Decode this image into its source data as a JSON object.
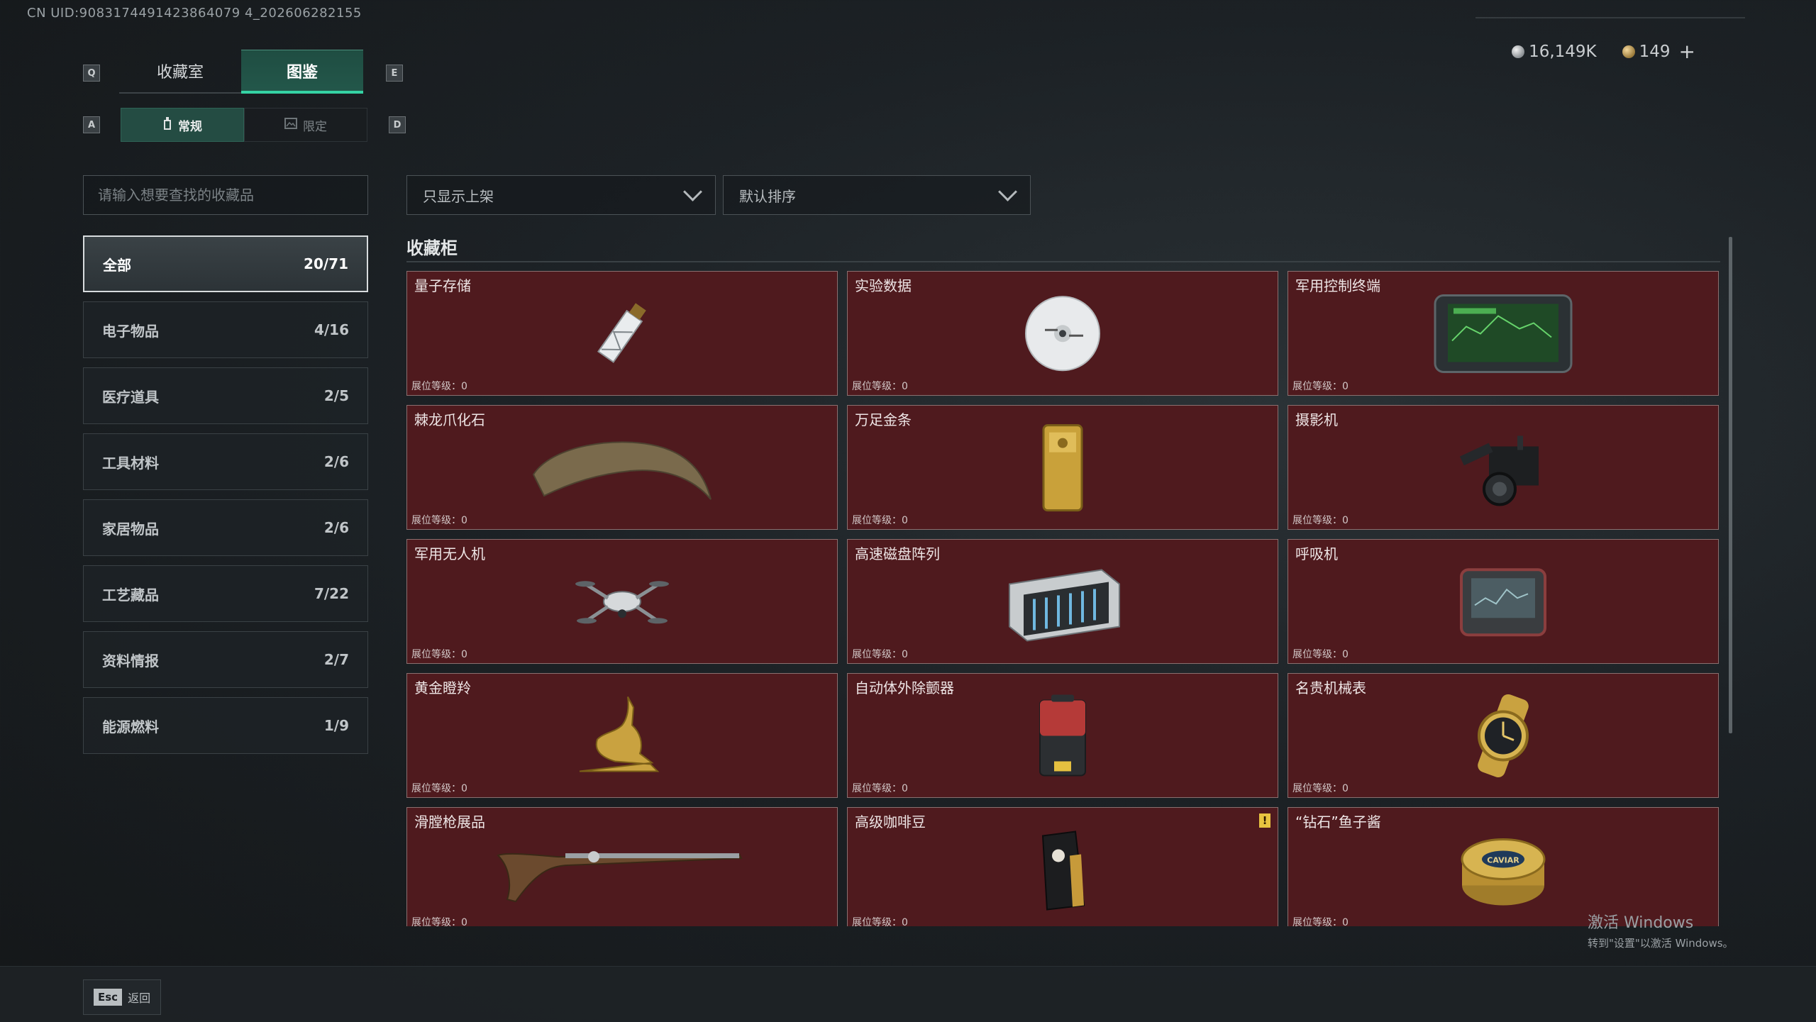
{
  "uid": "CN UID:9083174491423864079 4_202606282155",
  "currency": {
    "silver": "16,149K",
    "gold": "149",
    "plus": "+"
  },
  "keys": {
    "q": "Q",
    "e": "E",
    "a": "A",
    "d": "D"
  },
  "main_tabs": [
    {
      "label": "收藏室"
    },
    {
      "label": "图鉴"
    }
  ],
  "sub_tabs": [
    {
      "label": "常规"
    },
    {
      "label": "限定"
    }
  ],
  "search": {
    "placeholder": "请输入想要查找的收藏品"
  },
  "filter": {
    "selected": "只显示上架"
  },
  "sort": {
    "selected": "默认排序"
  },
  "categories": [
    {
      "label": "全部",
      "count": "20/71"
    },
    {
      "label": "电子物品",
      "count": "4/16"
    },
    {
      "label": "医疗道具",
      "count": "2/5"
    },
    {
      "label": "工具材料",
      "count": "2/6"
    },
    {
      "label": "家居物品",
      "count": "2/6"
    },
    {
      "label": "工艺藏品",
      "count": "7/22"
    },
    {
      "label": "资料情报",
      "count": "2/7"
    },
    {
      "label": "能源燃料",
      "count": "1/9"
    }
  ],
  "section_title": "收藏柜",
  "level_label": "展位等级：0",
  "items": [
    {
      "name": "量子存储",
      "icon": "usb-drive-icon"
    },
    {
      "name": "实验数据",
      "icon": "disc-icon"
    },
    {
      "name": "军用控制终端",
      "icon": "military-terminal-icon"
    },
    {
      "name": "棘龙爪化石",
      "icon": "claw-fossil-icon"
    },
    {
      "name": "万足金条",
      "icon": "gold-bar-icon"
    },
    {
      "name": "摄影机",
      "icon": "camera-icon"
    },
    {
      "name": "军用无人机",
      "icon": "drone-icon"
    },
    {
      "name": "高速磁盘阵列",
      "icon": "disk-array-icon"
    },
    {
      "name": "呼吸机",
      "icon": "ventilator-icon"
    },
    {
      "name": "黄金瞪羚",
      "icon": "golden-gazelle-icon"
    },
    {
      "name": "自动体外除颤器",
      "icon": "defibrillator-icon"
    },
    {
      "name": "名贵机械表",
      "icon": "watch-icon"
    },
    {
      "name": "滑膛枪展品",
      "icon": "musket-icon"
    },
    {
      "name": "高级咖啡豆",
      "icon": "coffee-bag-icon",
      "alert": "!"
    },
    {
      "name": "“钻石”鱼子酱",
      "icon": "caviar-tin-icon",
      "tin_text": "CAVIAR"
    }
  ],
  "watermark": {
    "line1": "激活 Windows",
    "line2": "转到\"设置\"以激活 Windows。"
  },
  "esc": {
    "key": "Esc",
    "label": "返回"
  }
}
